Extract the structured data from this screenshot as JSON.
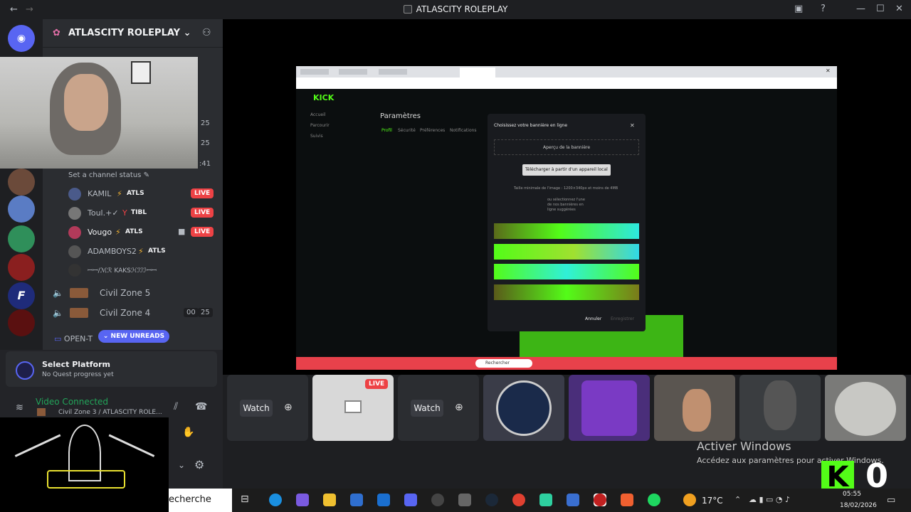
{
  "window": {
    "title": "ATLASCITY ROLEPLAY",
    "back_icon": "arrow-left-icon",
    "forward_icon": "arrow-right-icon"
  },
  "server": {
    "name": "ATLASCITY ROLEPLAY"
  },
  "channel_panel": {
    "status_prompt": "Set a channel status",
    "numbers": [
      "25",
      "25",
      ":41"
    ],
    "members": [
      {
        "name": "KAMIL",
        "tag": "ATLS",
        "live": "LIVE"
      },
      {
        "name": "Toul.+✓",
        "tag": "TIBL",
        "live": "LIVE"
      },
      {
        "name": "Vougo",
        "tag": "ATLS",
        "live": "LIVE"
      },
      {
        "name": "ADAMBOYS2",
        "tag": "ATLS",
        "live": ""
      },
      {
        "name": "ꟷꟷ/ℳℛ KAKSℋℐℐℐꟷꟷ",
        "tag": "",
        "live": ""
      }
    ],
    "voice_channels": [
      {
        "name": "Civil Zone 5",
        "count_a": "",
        "count_b": ""
      },
      {
        "name": "Civil Zone 4",
        "count_a": "00",
        "count_b": "25"
      }
    ],
    "open_channel": "OPEN-T",
    "new_unreads": "NEW UNREADS"
  },
  "quest": {
    "title": "Select Platform",
    "subtitle": "No Quest progress yet"
  },
  "voice_status": {
    "title": "Video Connected",
    "detail": "Civil Zone 3 / ATLASCITY ROLE..."
  },
  "browser": {
    "kick_logo": "KICK",
    "page_title": "Paramètres",
    "tabs": [
      "Profil",
      "Sécurité",
      "Préférences",
      "Notifications"
    ],
    "sidebar": [
      "Accueil",
      "Parcourir",
      "Suivis"
    ],
    "modal": {
      "title": "Choisissez votre bannière en ligne",
      "preview": "Aperçu de la bannière",
      "upload": "Télécharger à partir d'un appareil local",
      "hint": "Taille minimale de l'image : 1200×340px et moins de 4MB",
      "or_select": "ou sélectionnez l'une de nos bannières en ligne suggérées",
      "cancel": "Annuler",
      "save": "Enregistrer"
    },
    "taskbar_search": "Rechercher"
  },
  "tiles": [
    {
      "label": "Watch",
      "live": ""
    },
    {
      "label": "",
      "live": "LIVE"
    },
    {
      "label": "Watch",
      "live": ""
    }
  ],
  "activate": {
    "title": "Activer Windows",
    "subtitle": "Accédez aux paramètres pour activer Windows."
  },
  "taskbar": {
    "search": "echerche",
    "weather": "17°C",
    "time": "05:55",
    "date": "18/02/2026",
    "overlay_counter": "0"
  }
}
